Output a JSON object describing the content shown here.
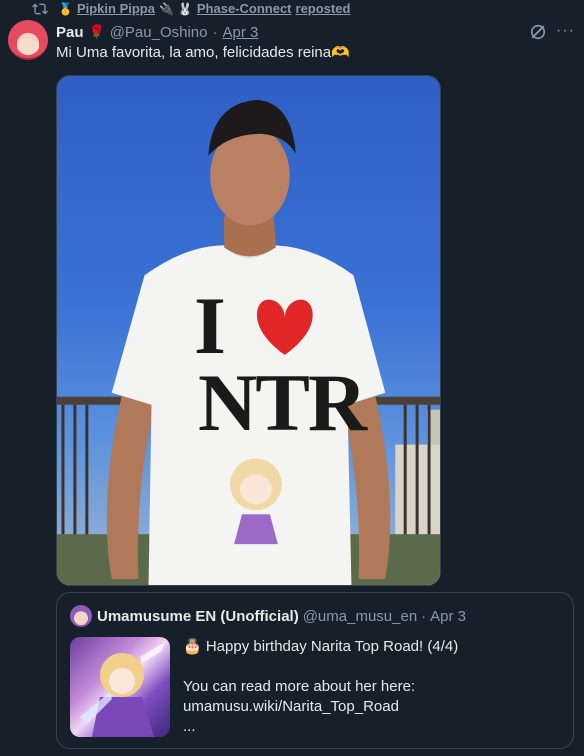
{
  "repost": {
    "names": [
      "Pipkin Pippa",
      "Phase-Connect"
    ],
    "emoji_1": "🥇",
    "emoji_2": "🔌",
    "emoji_3": "🐰",
    "suffix": "reposted"
  },
  "tweet": {
    "display_name": "Pau",
    "name_emoji": "🌹",
    "handle": "@Pau_Oshino",
    "separator": "·",
    "date": "Apr 3",
    "text": "Mi Uma favorita, la amo, felicidades reina🫶",
    "more": "···"
  },
  "photo": {
    "shirt_text_i": "I",
    "shirt_text_ntr": "NTR"
  },
  "quote": {
    "display_name": "Umamusume EN (Unofficial)",
    "handle": "@uma_musu_en",
    "separator": "·",
    "date": "Apr 3",
    "line1": "🎂 Happy birthday Narita Top Road! (4/4)",
    "line2": "You can read more about her here:",
    "line3": "umamusu.wiki/Narita_Top_Road",
    "line4": "..."
  },
  "colors": {
    "background": "#15202b",
    "text": "#e7e9ea",
    "muted": "#8b98a5",
    "border": "#38444d",
    "heart": "#e02626"
  }
}
